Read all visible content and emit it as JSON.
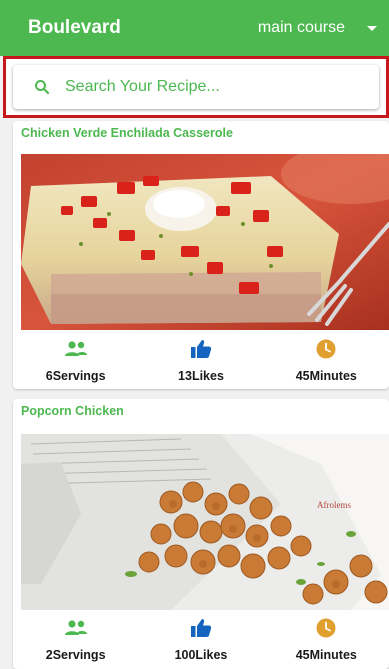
{
  "app": {
    "title": "Boulevard"
  },
  "category": {
    "selected": "main course"
  },
  "search": {
    "placeholder": "Search Your Recipe..."
  },
  "recipes": [
    {
      "title": "Chicken Verde Enchilada Casserole",
      "servings": "6Servings",
      "likes": "13Likes",
      "time": "45Minutes"
    },
    {
      "title": "Popcorn Chicken",
      "servings": "2Servings",
      "likes": "100Likes",
      "time": "45Minutes",
      "image_watermark": "Afrolems"
    }
  ],
  "icons": {
    "servings": "people-icon",
    "likes": "thumbs-up-icon",
    "time": "clock-icon"
  },
  "colors": {
    "brand_green": "#4cb84f",
    "search_outline": "#c8161d",
    "like_blue": "#1565c0",
    "clock_orange": "#e0a030"
  }
}
